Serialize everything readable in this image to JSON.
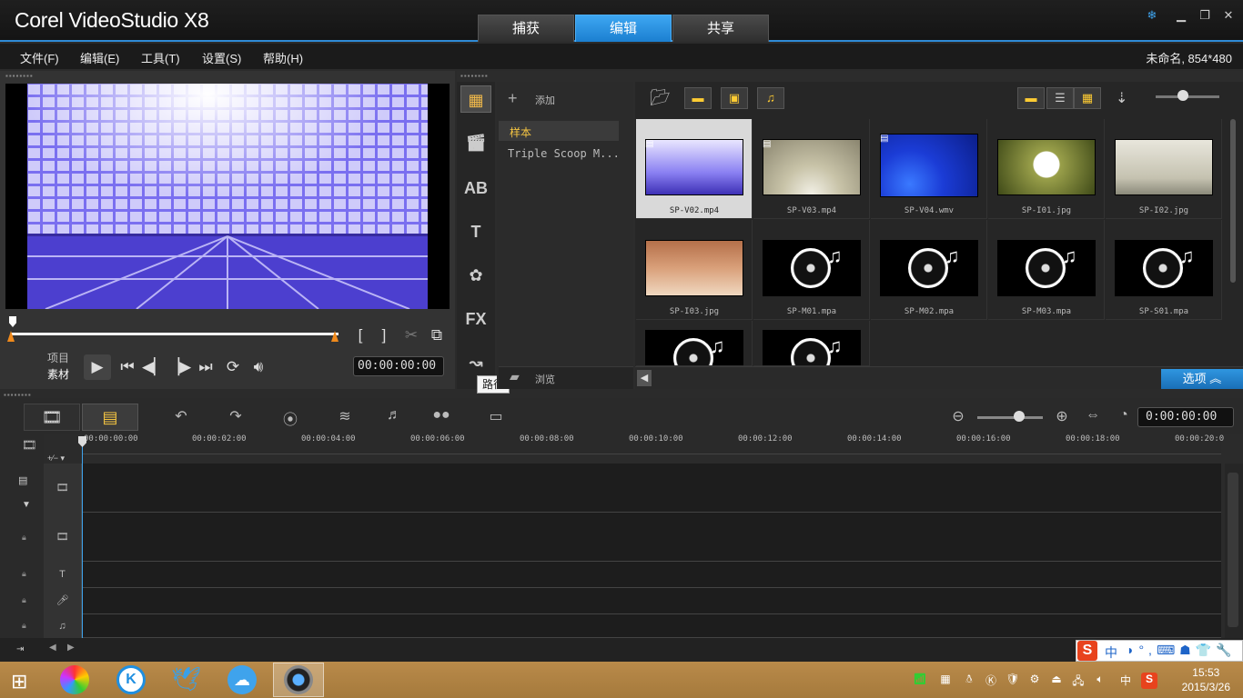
{
  "app": {
    "title": "Corel VideoStudio X8",
    "tabs": [
      "捕获",
      "编辑",
      "共享"
    ],
    "active_tab": "编辑"
  },
  "menu": [
    "文件(F)",
    "编辑(E)",
    "工具(T)",
    "设置(S)",
    "帮助(H)"
  ],
  "project_info": "未命名, 854*480",
  "player": {
    "mode_project": "项目",
    "mode_clip": "素材",
    "timecode": "00:00:00:00"
  },
  "library": {
    "add_label": "添加",
    "browse_label": "浏览",
    "folders": [
      "样本",
      "Triple Scoop M..."
    ],
    "tooltip": "路径",
    "options_label": "选项",
    "items": [
      "SP-V02.mp4",
      "SP-V03.mp4",
      "SP-V04.wmv",
      "SP-I01.jpg",
      "SP-I02.jpg",
      "SP-I03.jpg",
      "SP-M01.mpa",
      "SP-M02.mpa",
      "SP-M03.mpa",
      "SP-S01.mpa",
      "",
      ""
    ]
  },
  "timeline": {
    "timecode": "0:00:00:00",
    "ticks": [
      "00:00:00:00",
      "00:00:02:00",
      "00:00:04:00",
      "00:00:06:00",
      "00:00:08:00",
      "00:00:10:00",
      "00:00:12:00",
      "00:00:14:00",
      "00:00:16:00",
      "00:00:18:00",
      "00:00:20:0"
    ]
  },
  "taskbar": {
    "time": "15:53",
    "date": "2015/3/26",
    "ime_label": "中"
  }
}
